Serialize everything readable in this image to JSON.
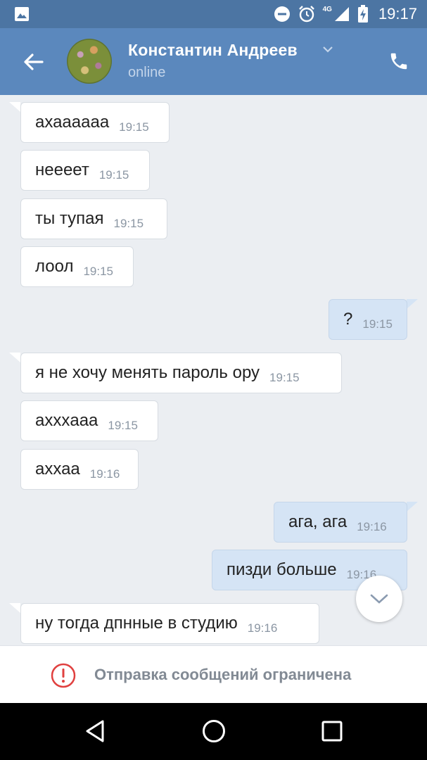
{
  "status_bar": {
    "time": "19:17",
    "network": "4G"
  },
  "header": {
    "name": "Константин Андреев",
    "status": "online"
  },
  "messages": [
    {
      "dir": "in",
      "text": "ахаааааа",
      "time": "19:15"
    },
    {
      "dir": "in",
      "text": "неееет",
      "time": "19:15"
    },
    {
      "dir": "in",
      "text": "ты тупая",
      "time": "19:15"
    },
    {
      "dir": "in",
      "text": "лоол",
      "time": "19:15"
    },
    {
      "dir": "out",
      "text": "?",
      "time": "19:15"
    },
    {
      "dir": "in",
      "text": "я не хочу менять пароль ору",
      "time": "19:15"
    },
    {
      "dir": "in",
      "text": "аххxааа",
      "time": "19:15"
    },
    {
      "dir": "in",
      "text": "аххаа",
      "time": "19:16"
    },
    {
      "dir": "out",
      "text": "ага, ага",
      "time": "19:16"
    },
    {
      "dir": "out",
      "text": "пизди больше",
      "time": "19:16"
    },
    {
      "dir": "in",
      "text": "ну тогда дпнные в студию",
      "time": "19:16"
    }
  ],
  "restriction": {
    "text": "Отправка сообщений ограничена"
  },
  "colors": {
    "header": "#5b88bd",
    "status_bar": "#4c75a3",
    "background": "#ebeef2",
    "outgoing_bubble": "#d5e4f5",
    "warning": "#e0403f"
  }
}
